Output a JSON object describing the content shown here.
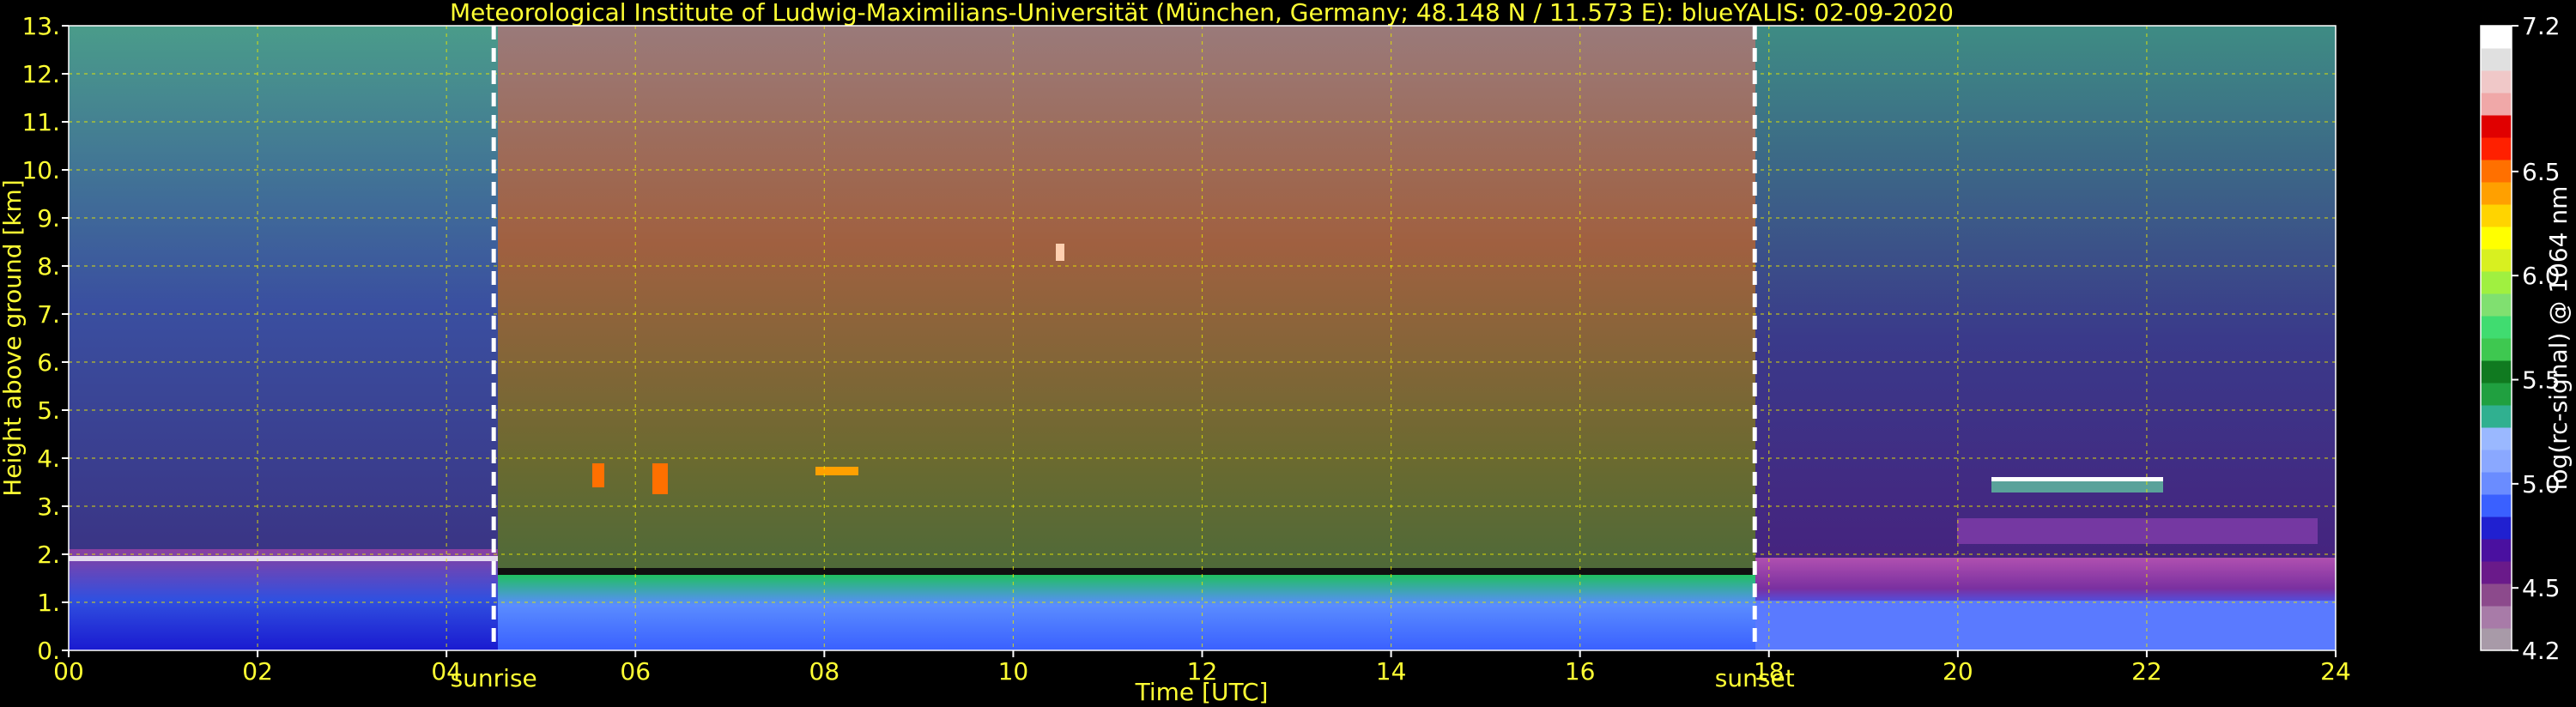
{
  "chart_data": {
    "type": "heatmap",
    "title": "Meteorological Institute of Ludwig-Maximilians-Universität (München, Germany; 48.148 N / 11.573 E):     blueYALIS: 02-09-2020",
    "xlabel": "Time [UTC]",
    "ylabel": "Height above ground [km]",
    "xlim": [
      0,
      24
    ],
    "ylim": [
      0,
      13
    ],
    "x_ticks": [
      "00",
      "02",
      "04",
      "06",
      "08",
      "10",
      "12",
      "14",
      "16",
      "18",
      "20",
      "22",
      "24"
    ],
    "y_ticks": [
      "0.",
      "1.",
      "2.",
      "3.",
      "4.",
      "5.",
      "6.",
      "7.",
      "8.",
      "9.",
      "10.",
      "11.",
      "12.",
      "13."
    ],
    "grid": true,
    "events": [
      {
        "label": "sunrise",
        "time": 4.5
      },
      {
        "label": "sunset",
        "time": 17.85
      }
    ],
    "colorbar": {
      "label": "log(rc-signal) @ 1064 nm",
      "range": [
        4.2,
        7.2
      ],
      "ticks": [
        "4.2",
        "4.5",
        "5.0",
        "5.5",
        "6.0",
        "6.5",
        "7.2"
      ],
      "tick_values": [
        4.2,
        4.5,
        5.0,
        5.5,
        6.0,
        6.5,
        7.2
      ],
      "colors": [
        "#a89aa8",
        "#a87ba8",
        "#8c4a8c",
        "#6a1a8a",
        "#4a10a0",
        "#2020d0",
        "#3a60ff",
        "#6a8cff",
        "#8aa8ff",
        "#9ab8ff",
        "#30b090",
        "#20a040",
        "#107a20",
        "#3ec850",
        "#40dc70",
        "#80e070",
        "#a0f040",
        "#d8f020",
        "#ffff00",
        "#ffd400",
        "#ffa000",
        "#ff7000",
        "#ff2000",
        "#e00000",
        "#f0a8a8",
        "#f0c8c8",
        "#e0e0e0",
        "#ffffff"
      ]
    }
  }
}
